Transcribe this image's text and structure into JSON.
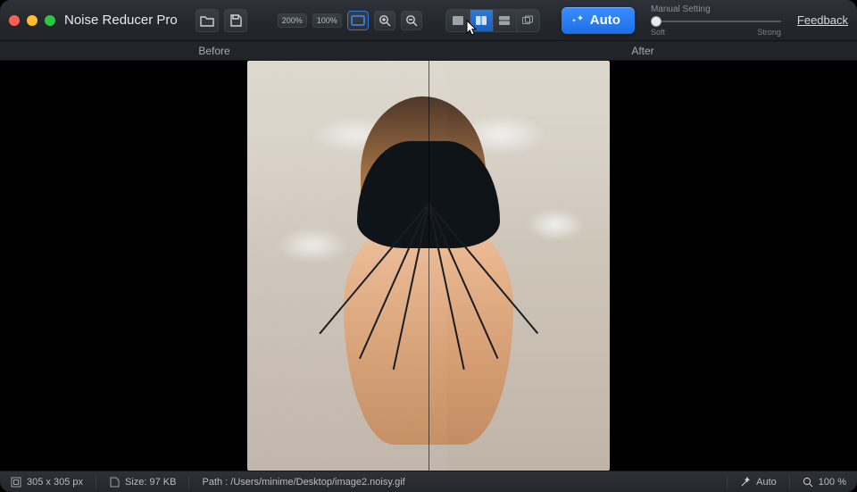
{
  "app": {
    "title": "Noise Reducer Pro"
  },
  "toolbar": {
    "zoom_badge_200": "200%",
    "zoom_badge_100": "100%"
  },
  "auto_button": {
    "label": "Auto"
  },
  "manual": {
    "title": "Manual Setting",
    "low_label": "Soft",
    "high_label": "Strong",
    "value_percent": 0
  },
  "feedback_link": "Feedback",
  "compare": {
    "before": "Before",
    "after": "After"
  },
  "status": {
    "dimensions_label": "305 x 305 px",
    "size_label": "Size: 97 KB",
    "path_label": "Path : /Users/minime/Desktop/image2.noisy.gif",
    "auto_label": "Auto",
    "zoom_label": "100 %"
  },
  "icons": {
    "open": "folder-open-icon",
    "save": "save-icon",
    "fit": "fit-screen-icon",
    "zoom_in": "zoom-in-icon",
    "zoom_out": "zoom-out-icon",
    "wand": "wand-icon",
    "view_single": "view-single-icon",
    "view_split_v": "view-split-vertical-icon",
    "view_split_h": "view-split-horizontal-icon",
    "view_dual": "view-dual-icon",
    "dimensions": "dimensions-icon",
    "disk": "disk-icon",
    "zoom": "magnifier-icon"
  }
}
